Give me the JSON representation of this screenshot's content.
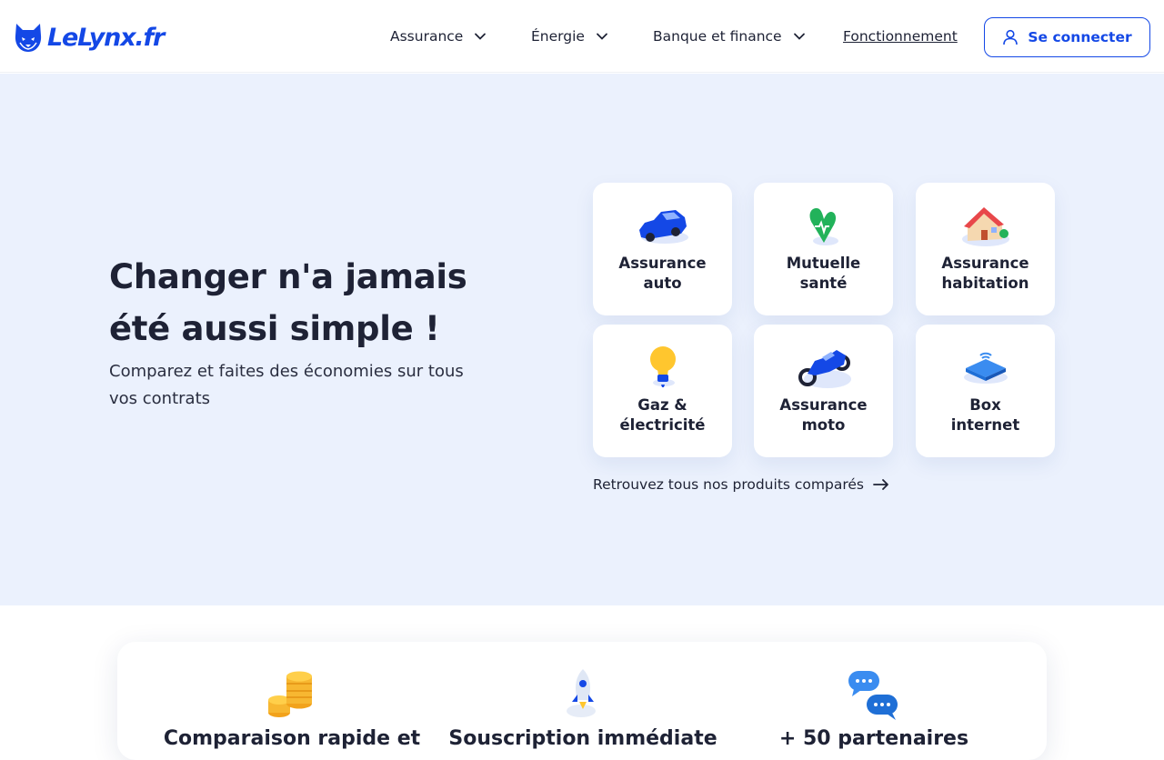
{
  "header": {
    "logo_text": "LeLynx.fr",
    "nav": [
      {
        "label": "Assurance",
        "has_dropdown": true
      },
      {
        "label": "Énergie",
        "has_dropdown": true
      },
      {
        "label": "Banque et finance",
        "has_dropdown": true
      },
      {
        "label": "Fonctionnement",
        "has_dropdown": false
      }
    ],
    "login_label": "Se connecter"
  },
  "hero": {
    "title": "Changer n'a jamais été aussi simple !",
    "subtitle": "Comparez et faites des économies sur tous vos contrats",
    "cards": [
      {
        "label": "Assurance\nauto",
        "icon": "car-icon"
      },
      {
        "label": "Mutuelle\nsanté",
        "icon": "heart-health-icon"
      },
      {
        "label": "Assurance\nhabitation",
        "icon": "house-icon"
      },
      {
        "label": "Gaz &\nélectricité",
        "icon": "light-bulb-icon"
      },
      {
        "label": "Assurance\nmoto",
        "icon": "motorcycle-icon"
      },
      {
        "label": "Box\ninternet",
        "icon": "internet-box-icon"
      }
    ],
    "all_products_label": "Retrouvez tous nos produits comparés"
  },
  "features": [
    {
      "label": "Comparaison rapide et",
      "icon": "coins-icon"
    },
    {
      "label": "Souscription immédiate",
      "icon": "rocket-icon"
    },
    {
      "label": "+ 50 partenaires",
      "icon": "chat-bubbles-icon"
    }
  ],
  "colors": {
    "brand": "#1448e6",
    "hero_bg": "#ebf1fd",
    "text": "#1e2235"
  }
}
